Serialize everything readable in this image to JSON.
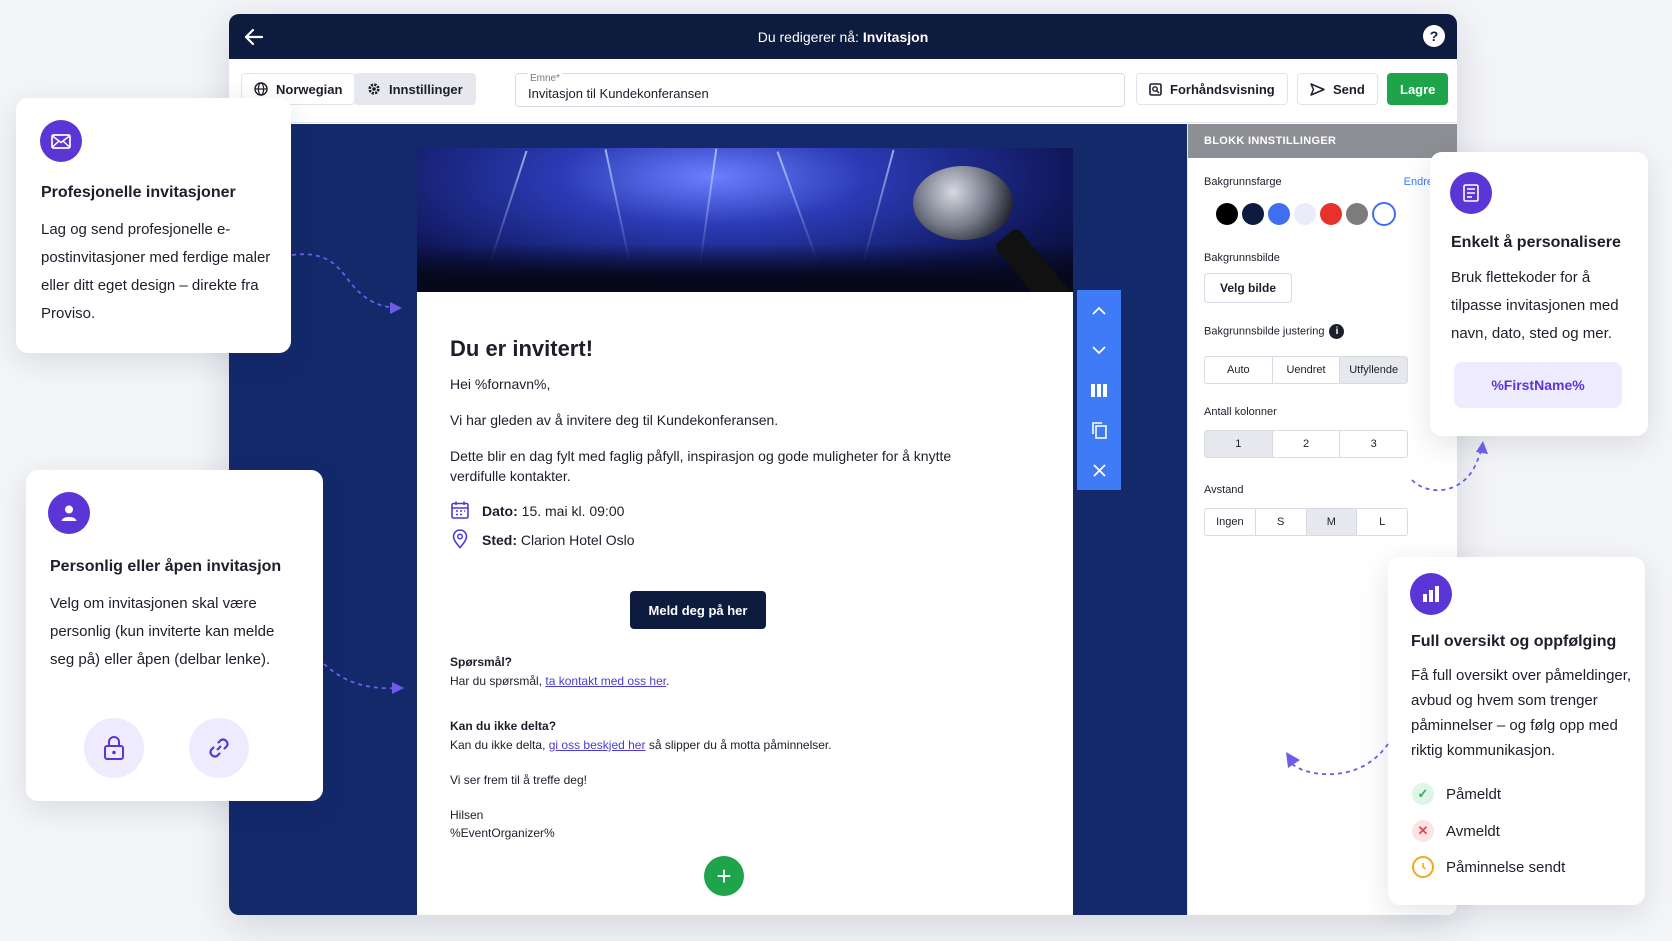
{
  "window": {
    "title_prefix": "Du redigerer nå:",
    "title_doc": "Invitasjon",
    "help_label": "?"
  },
  "toolbar": {
    "language": "Norwegian",
    "settings": "Innstillinger",
    "subject_label": "Emne*",
    "subject_value": "Invitasjon til Kundekonferansen",
    "preview": "Forhåndsvisning",
    "send": "Send",
    "save": "Lagre"
  },
  "email": {
    "title": "Du er invitert!",
    "greeting": "Hei %fornavn%,",
    "intro": "Vi har gleden av å invitere deg til Kundekonferansen.",
    "body": "Dette blir en dag fylt med faglig påfyll, inspirasjon og gode muligheter for å knytte verdifulle kontakter.",
    "date_label": "Dato:",
    "date_value": "15. mai kl. 09:00",
    "place_label": "Sted:",
    "place_value": "Clarion Hotel Oslo",
    "cta": "Meld deg på her",
    "q_heading": "Spørsmål?",
    "q_text_before": "Har du spørsmål,",
    "q_link": "ta kontakt med oss her",
    "q_text_after": ".",
    "decline_heading": "Kan du ikke delta?",
    "decline_before": "Kan du ikke delta,",
    "decline_link": "gi oss beskjed her",
    "decline_after": "så slipper du å motta påminnelser.",
    "closing": "Vi ser frem til å treffe deg!",
    "regards": "Hilsen",
    "organizer": "%EventOrganizer%",
    "add_label": "+"
  },
  "settings": {
    "header": "BLOKK INNSTILLINGER",
    "bg_color_label": "Bakgrunnsfarge",
    "change_link": "Endre",
    "swatches": [
      "#000000",
      "#0d1b3e",
      "#3f6ff0",
      "#ecebfb",
      "#e8302d",
      "#7c7c7c",
      "#ffffff"
    ],
    "bg_image_label": "Bakgrunnsbilde",
    "choose_image": "Velg bilde",
    "alignment_label": "Bakgrunnsbilde justering",
    "alignment_options": [
      "Auto",
      "Uendret",
      "Utfyllende"
    ],
    "alignment_selected": "Utfyllende",
    "columns_label": "Antall kolonner",
    "columns_options": [
      "1",
      "2",
      "3"
    ],
    "columns_selected": "1",
    "spacing_label": "Avstand",
    "spacing_options": [
      "Ingen",
      "S",
      "M",
      "L"
    ],
    "spacing_selected": "M"
  },
  "cards": {
    "invites": {
      "title": "Profesjonelle invitasjoner",
      "text": "Lag og send profesjonelle e-postinvitasjoner med ferdige maler eller ditt eget design – direkte fra Proviso."
    },
    "personal": {
      "title": "Personlig eller åpen invitasjon",
      "text": "Velg om invitasjonen skal være personlig (kun inviterte kan melde seg på) eller åpen (delbar lenke)."
    },
    "customize": {
      "title": "Enkelt å personalisere",
      "text": "Bruk flettekoder for å tilpasse invitasjonen med navn, dato, sted og mer.",
      "chip": "%FirstName%"
    },
    "overview": {
      "title": "Full oversikt og oppfølging",
      "text": "Få full oversikt over påmeldinger, avbud og hvem som trenger påminnelser – og følg opp med riktig kommunikasjon.",
      "statuses": [
        {
          "label": "Påmeldt",
          "color": "#2bb35a"
        },
        {
          "label": "Avmeldt",
          "color": "#e84545"
        },
        {
          "label": "Påminnelse sendt",
          "color": "#f2a81d"
        }
      ]
    }
  },
  "colors": {
    "accent": "#5b35d5",
    "navy": "#0d1b3e",
    "green": "#1ea44b",
    "blue": "#3f7bf7"
  }
}
